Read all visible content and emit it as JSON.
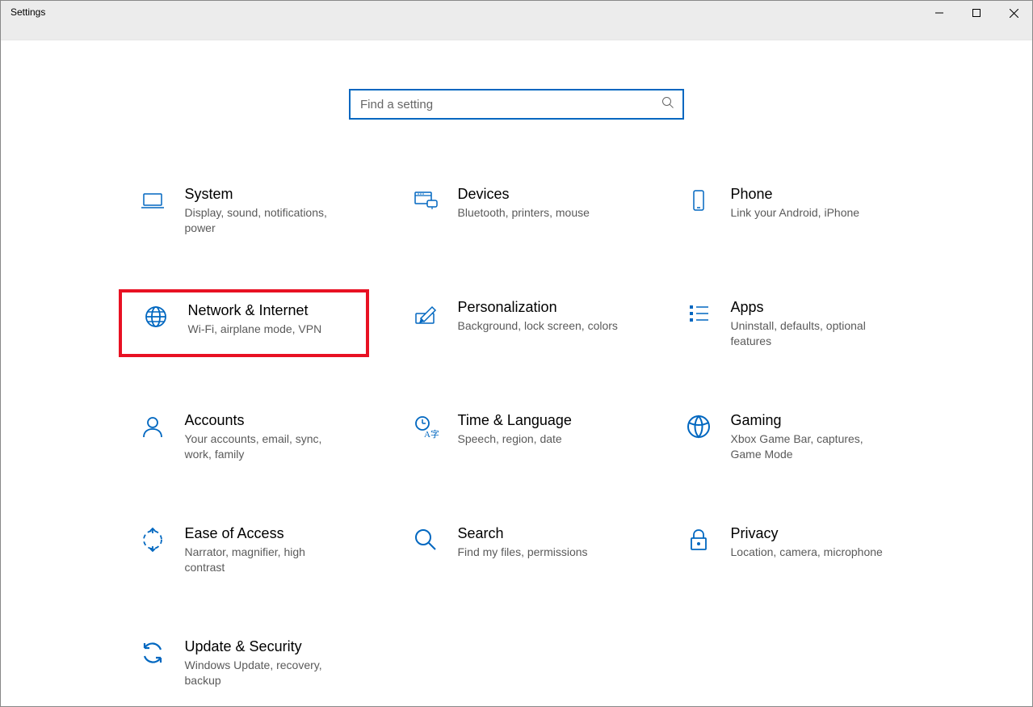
{
  "window": {
    "title": "Settings"
  },
  "search": {
    "placeholder": "Find a setting"
  },
  "categories": [
    {
      "id": "system",
      "icon": "laptop-icon",
      "title": "System",
      "desc": "Display, sound, notifications, power"
    },
    {
      "id": "devices",
      "icon": "devices-icon",
      "title": "Devices",
      "desc": "Bluetooth, printers, mouse"
    },
    {
      "id": "phone",
      "icon": "phone-icon",
      "title": "Phone",
      "desc": "Link your Android, iPhone"
    },
    {
      "id": "network",
      "icon": "globe-icon",
      "title": "Network & Internet",
      "desc": "Wi-Fi, airplane mode, VPN",
      "highlighted": true
    },
    {
      "id": "personalization",
      "icon": "pen-icon",
      "title": "Personalization",
      "desc": "Background, lock screen, colors"
    },
    {
      "id": "apps",
      "icon": "apps-icon",
      "title": "Apps",
      "desc": "Uninstall, defaults, optional features"
    },
    {
      "id": "accounts",
      "icon": "person-icon",
      "title": "Accounts",
      "desc": "Your accounts, email, sync, work, family"
    },
    {
      "id": "time",
      "icon": "time-icon",
      "title": "Time & Language",
      "desc": "Speech, region, date"
    },
    {
      "id": "gaming",
      "icon": "gaming-icon",
      "title": "Gaming",
      "desc": "Xbox Game Bar, captures, Game Mode"
    },
    {
      "id": "ease",
      "icon": "ease-icon",
      "title": "Ease of Access",
      "desc": "Narrator, magnifier, high contrast"
    },
    {
      "id": "search",
      "icon": "search-icon",
      "title": "Search",
      "desc": "Find my files, permissions"
    },
    {
      "id": "privacy",
      "icon": "lock-icon",
      "title": "Privacy",
      "desc": "Location, camera, microphone"
    },
    {
      "id": "update",
      "icon": "update-icon",
      "title": "Update & Security",
      "desc": "Windows Update, recovery, backup"
    }
  ],
  "colors": {
    "accent": "#0067c0",
    "highlight_border": "#e81123"
  }
}
